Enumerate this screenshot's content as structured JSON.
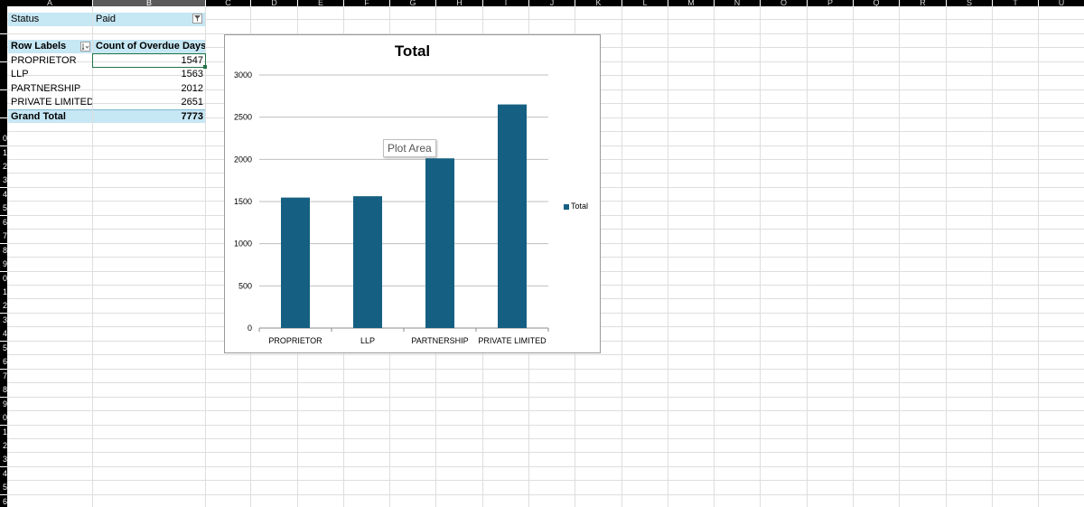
{
  "columns": [
    "A",
    "B",
    "C",
    "D",
    "E",
    "F",
    "G",
    "H",
    "I",
    "J",
    "K",
    "L",
    "M",
    "N",
    "O",
    "P",
    "Q",
    "R",
    "S",
    "T",
    "U"
  ],
  "row_numbers": [
    "",
    "",
    "",
    "",
    "",
    "",
    "",
    "",
    "",
    "0",
    "1",
    "2",
    "3",
    "4",
    "5",
    "6",
    "7",
    "8",
    "9",
    "0",
    "1",
    "2",
    "3",
    "4",
    "5",
    "6",
    "7",
    "8",
    "9",
    "0",
    "1",
    "2",
    "3",
    "4",
    "5",
    "6"
  ],
  "filter": {
    "label": "Status",
    "value": "Paid"
  },
  "pivot": {
    "header_row_labels": "Row Labels",
    "header_value": "Count of Overdue Days",
    "rows": [
      {
        "label": "PROPRIETOR",
        "value": "1547"
      },
      {
        "label": "LLP",
        "value": "1563"
      },
      {
        "label": "PARTNERSHIP",
        "value": "2012"
      },
      {
        "label": "PRIVATE LIMITED",
        "value": "2651"
      }
    ],
    "grand_total_label": "Grand Total",
    "grand_total_value": "7773"
  },
  "chart_data": {
    "type": "bar",
    "title": "Total",
    "categories": [
      "PROPRIETOR",
      "LLP",
      "PARTNERSHIP",
      "PRIVATE LIMITED"
    ],
    "series": [
      {
        "name": "Total",
        "values": [
          1547,
          1563,
          2012,
          2651
        ],
        "color": "#156082"
      }
    ],
    "ylim": [
      0,
      3000
    ],
    "yticks": [
      "0",
      "500",
      "1000",
      "1500",
      "2000",
      "2500",
      "3000"
    ],
    "grid": true,
    "legend": "right"
  },
  "tooltip": "Plot Area",
  "colors": {
    "bar": "#156082",
    "pivot_header": "#c6e7f4",
    "selection": "#217346"
  }
}
